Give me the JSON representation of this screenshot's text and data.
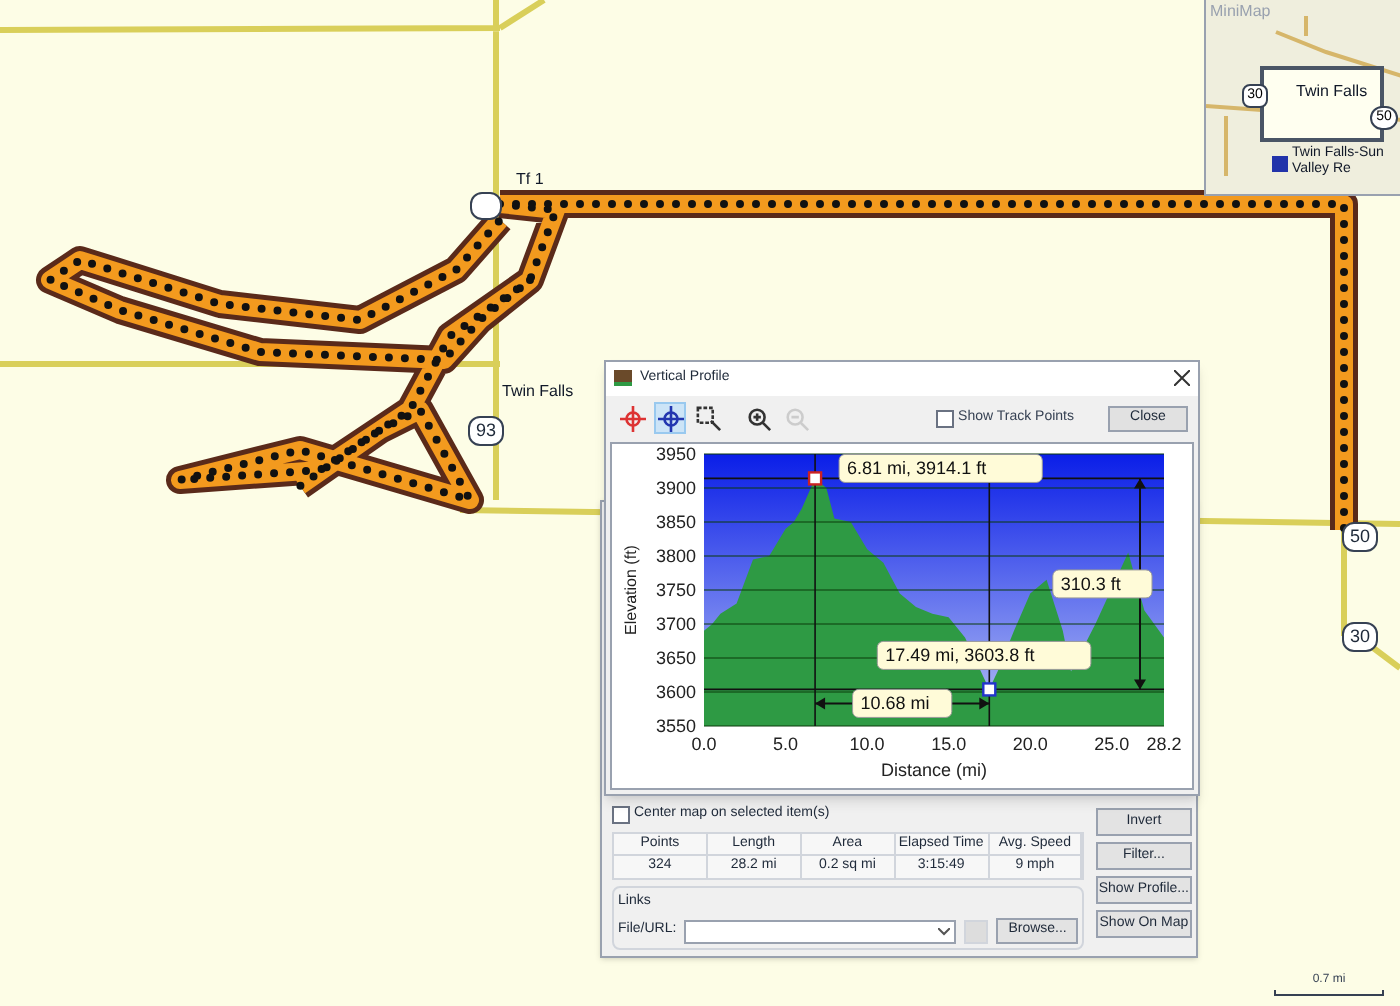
{
  "map": {
    "labels": [
      "Tf 1",
      "Twin Falls"
    ],
    "shields": [
      "93",
      "50",
      "30"
    ]
  },
  "minimap": {
    "title": "MiniMap",
    "labels": [
      "Twin Falls",
      "Twin Falls-Sun Valley Re"
    ],
    "shields": [
      "30",
      "50"
    ]
  },
  "scale": "0.7 mi",
  "profile_dialog": {
    "title": "Vertical Profile",
    "tools": [
      {
        "kind": "target",
        "selected": false,
        "disabled": false
      },
      {
        "kind": "crosshair",
        "selected": true,
        "disabled": false
      },
      {
        "kind": "zoom_box",
        "selected": false,
        "disabled": false
      },
      {
        "kind": "zoom_in",
        "selected": false,
        "disabled": false
      },
      {
        "kind": "zoom_out",
        "selected": false,
        "disabled": true
      }
    ],
    "show_track_points": {
      "label": "Show Track Points",
      "checked": false
    },
    "close": "Close",
    "chart_data": {
      "type": "area",
      "xlabel": "Distance (mi)",
      "ylabel": "Elevation (ft)",
      "x": [
        0,
        0.5,
        1,
        2,
        3,
        4,
        5,
        5.5,
        6,
        6.81,
        7.5,
        8,
        9,
        10,
        11,
        12,
        13,
        14,
        15,
        16,
        17,
        17.49,
        18,
        19,
        20,
        21,
        22,
        22.5,
        23,
        24,
        25,
        26,
        27,
        28.2
      ],
      "series": [
        {
          "color": "#2e9a44",
          "values": [
            3690,
            3700,
            3715,
            3730,
            3795,
            3800,
            3840,
            3850,
            3870,
            3914,
            3900,
            3855,
            3850,
            3810,
            3790,
            3745,
            3725,
            3715,
            3710,
            3680,
            null,
            3604,
            3630,
            3690,
            3745,
            3765,
            3690,
            3630,
            null,
            3700,
            null,
            3805,
            3720,
            3680
          ]
        }
      ],
      "grid": true,
      "xlim": [
        0,
        28.2
      ],
      "ylim": [
        3550,
        3950
      ],
      "xticks": [
        {
          "value": 0,
          "label": "0.0"
        },
        {
          "value": 5,
          "label": "5.0"
        },
        {
          "value": 10,
          "label": "10.0"
        },
        {
          "value": 15,
          "label": "15.0"
        },
        {
          "value": 20,
          "label": "20.0"
        },
        {
          "value": 25,
          "label": "25.0"
        },
        {
          "value": 28.2,
          "label": "28.2"
        }
      ],
      "yticks": [
        3550,
        3600,
        3650,
        3700,
        3750,
        3800,
        3850,
        3900,
        3950
      ],
      "annotations": [
        {
          "x": 6.81,
          "y": 3914.1,
          "text": "6.81 mi, 3914.1 ft"
        },
        {
          "x": 17.49,
          "y": 3603.8,
          "text": "17.49 mi, 3603.8 ft"
        }
      ]
    },
    "measurements": {
      "distance": "10.68 mi",
      "height": "310.3 ft"
    }
  },
  "properties": {
    "center_map": {
      "label": "Center map on selected item(s)",
      "checked": false
    },
    "stats": {
      "columns": [
        "Points",
        "Length",
        "Area",
        "Elapsed Time",
        "Avg. Speed"
      ],
      "values": [
        "324",
        "28.2 mi",
        "0.2 sq mi",
        "3:15:49",
        "9 mph"
      ]
    },
    "links": {
      "title": "Links",
      "field_label": "File/URL:",
      "browse": "Browse..."
    },
    "buttons": [
      "Invert",
      "Filter...",
      "Show Profile...",
      "Show On Map"
    ]
  }
}
